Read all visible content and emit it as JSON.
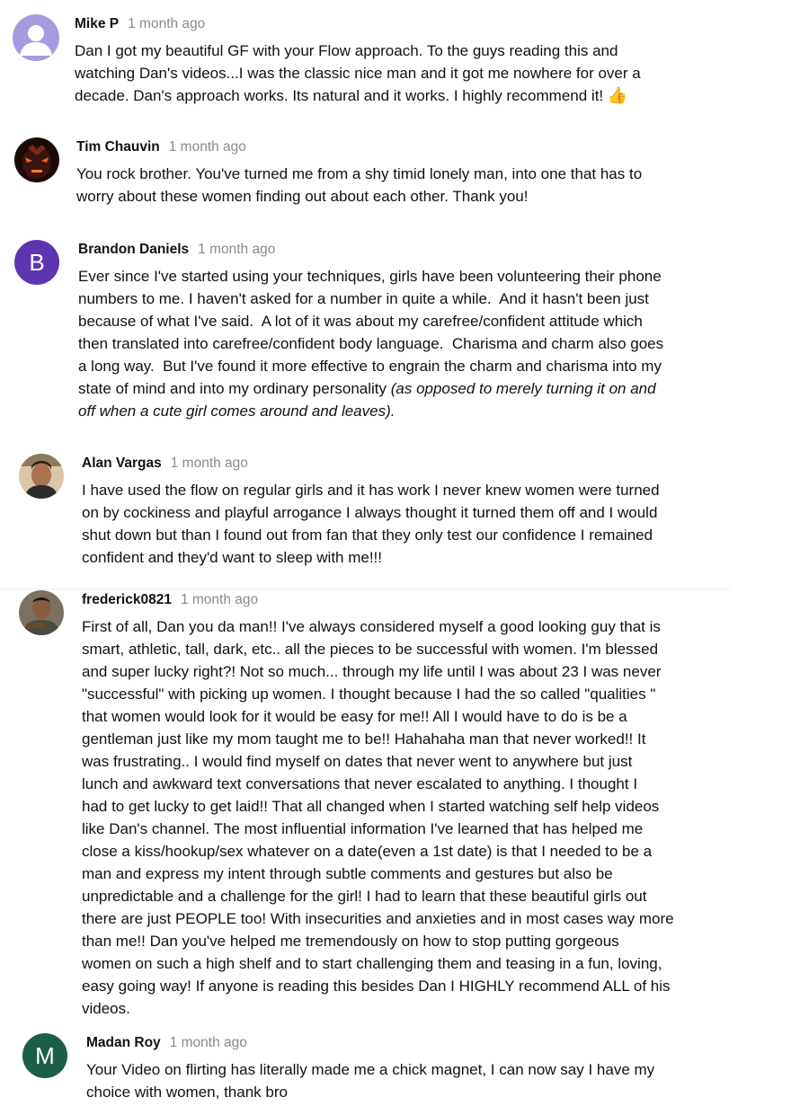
{
  "comments": [
    {
      "author": "Mike P",
      "time": "1 month ago",
      "avatar": "default-user-icon",
      "text": "Dan I got my beautiful GF with your Flow approach. To the guys reading this and\nwatching Dan's videos...I was the classic nice man and it got me nowhere for over a\ndecade. Dan's approach works. Its natural and it works. I highly recommend it!",
      "emoji": "👍"
    },
    {
      "author": "Tim Chauvin",
      "time": "1 month ago",
      "avatar": "profile-photo",
      "text": "You rock brother. You've turned me from a shy timid lonely man, into one that has to\nworry about these women finding out about each other. Thank you!"
    },
    {
      "author": "Brandon Daniels",
      "time": "1 month ago",
      "avatar_letter": "B",
      "avatar_color": "#5e35b1",
      "text": "Ever since I've started using your techniques, girls have been volunteering their phone\nnumbers to me. I haven't asked for a number in quite a while.  And it hasn't been just\nbecause of what I've said.  A lot of it was about my carefree/confident attitude which\nthen translated into carefree/confident body language.  Charisma and charm also goes\na long way.  But I've found it more effective to engrain the charm and charisma into my\nstate of mind and into my ordinary personality ",
      "text_italic": "(as opposed to merely turning it on and\noff when a cute girl comes around and leaves)."
    },
    {
      "author": "Alan Vargas",
      "time": "1 month ago",
      "avatar": "profile-photo",
      "text": "I have used the flow on regular girls and it has work I never knew women were turned\non by cockiness and playful arrogance I always thought it turned them off and I would\nshut down but than I found out from fan that they only test our confidence I remained\nconfident and they'd want to sleep with me!!!"
    },
    {
      "author": "frederick0821",
      "time": "1 month ago",
      "avatar": "profile-photo",
      "text": "First of all, Dan you da man!! I've always considered myself a good looking guy that is\nsmart, athletic, tall, dark, etc.. all the pieces to be successful with women. I'm blessed\nand super lucky right?! Not so much... through my life until I was about 23 I was never\n\"successful\" with picking up women. I thought because I had the so called \"qualities \"\nthat women would look for it would be easy for me!! All I would have to do is be a\ngentleman just like my mom taught me to be!! Hahahaha man that never worked!! It\nwas frustrating.. I would find myself on dates that never went to anywhere but just\nlunch and awkward text conversations that never escalated to anything. I thought I\nhad to get lucky to get laid!! That all changed when I started watching self help videos\nlike Dan's channel. The most influential information I've learned that has helped me\nclose a kiss/hookup/sex whatever on a date(even a 1st date) is that I needed to be a\nman and express my intent through subtle comments and gestures but also be\nunpredictable and a challenge for the girl! I had to learn that these beautiful girls out\nthere are just PEOPLE too! With insecurities and anxieties and in most cases way more\nthan me!! Dan you've helped me tremendously on how to stop putting gorgeous\nwomen on such a high shelf and to start challenging them and teasing in a fun, loving,\neasy going way! If anyone is reading this besides Dan I HIGHLY recommend ALL of his\nvideos."
    },
    {
      "author": "Madan Roy",
      "time": "1 month ago",
      "avatar_letter": "M",
      "avatar_color": "#1b5e4a",
      "text": "Your Video on flirting has literally made me a chick magnet, I can now say I have my\nchoice with women, thank bro"
    }
  ]
}
